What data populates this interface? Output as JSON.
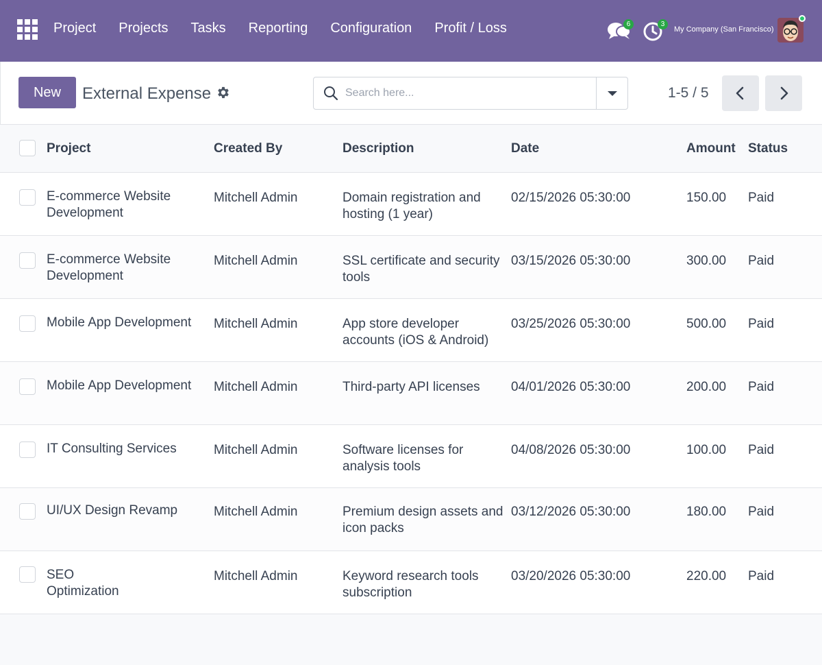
{
  "navbar": {
    "brand": "Project",
    "menu": [
      "Projects",
      "Tasks",
      "Reporting",
      "Configuration",
      "Profit / Loss"
    ],
    "messages_count": "6",
    "activities_count": "3",
    "company": "My Company (San Francisco)",
    "color": "#71639e"
  },
  "control_panel": {
    "new_label": "New",
    "title": "External Expense",
    "search_placeholder": "Search here...",
    "pager": "1-5 / 5"
  },
  "table": {
    "headers": {
      "project": "Project",
      "created_by": "Created By",
      "description": "Description",
      "date": "Date",
      "amount": "Amount",
      "status": "Status"
    },
    "rows": [
      {
        "project": "E-commerce Website Development",
        "created_by": "Mitchell Admin",
        "description": "Domain registration and hosting (1 year)",
        "date": "02/15/2026 05:30:00",
        "amount": "150.00",
        "status": "Paid"
      },
      {
        "project": "E-commerce Website Development",
        "created_by": "Mitchell Admin",
        "description": "SSL certificate and security tools",
        "date": "03/15/2026 05:30:00",
        "amount": "300.00",
        "status": "Paid"
      },
      {
        "project": "Mobile App Development",
        "created_by": "Mitchell Admin",
        "description": "App store developer accounts (iOS & Android)",
        "date": "03/25/2026 05:30:00",
        "amount": "500.00",
        "status": "Paid"
      },
      {
        "project": "Mobile App Development",
        "created_by": "Mitchell Admin",
        "description": "Third-party API licenses",
        "date": "04/01/2026 05:30:00",
        "amount": "200.00",
        "status": "Paid"
      },
      {
        "project": "IT Consulting Services",
        "created_by": "Mitchell Admin",
        "description": "Software licenses for analysis tools",
        "date": "04/08/2026 05:30:00",
        "amount": "100.00",
        "status": "Paid"
      },
      {
        "project": "UI/UX Design Revamp",
        "created_by": "Mitchell Admin",
        "description": "Premium design assets and icon packs",
        "date": "03/12/2026 05:30:00",
        "amount": "180.00",
        "status": "Paid"
      },
      {
        "project": "SEO Optimization",
        "created_by": "Mitchell Admin",
        "description": "Keyword research tools subscription",
        "date": "03/20/2026 05:30:00",
        "amount": "220.00",
        "status": "Paid"
      }
    ]
  }
}
